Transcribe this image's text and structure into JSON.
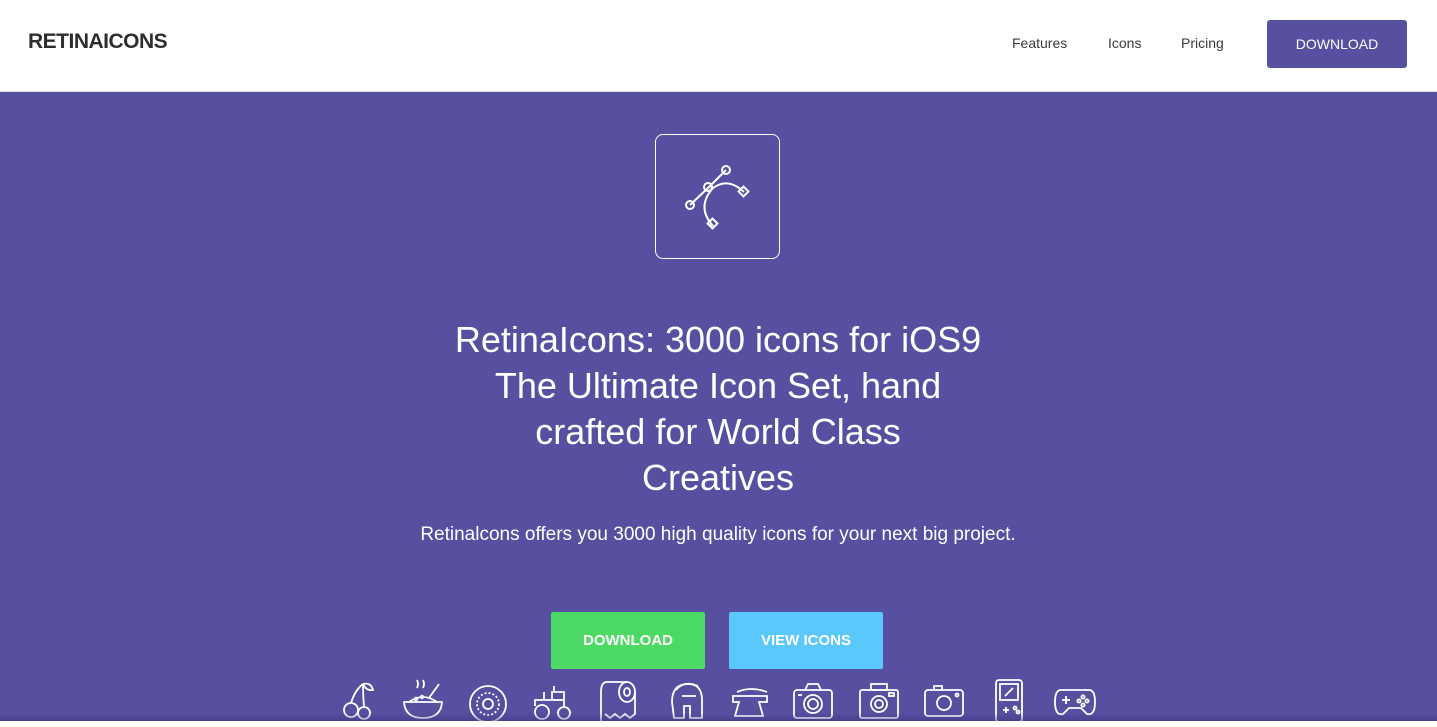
{
  "nav": {
    "brand": "RETINAICONS",
    "links": [
      "Features",
      "Icons",
      "Pricing"
    ],
    "download_label": "DOWNLOAD"
  },
  "hero": {
    "headline_lines": [
      "RetinaIcons: 3000 icons for iOS9",
      "The Ultimate Icon Set, hand",
      "crafted for World Class",
      "Creatives"
    ],
    "subline": "Retinalcons offers you 3000 high quality icons for your next big project.",
    "download_label": "DOWNLOAD",
    "view_icons_label": "VIEW ICONS",
    "logo_icon": "bezier-curve-icon",
    "icons": [
      "cherry-icon",
      "bowl-icon",
      "donut-icon",
      "tractor-icon",
      "toilet-paper-icon",
      "spartan-helmet-icon",
      "anvil-icon",
      "camera-icon",
      "camera-icon",
      "camera-icon",
      "gameboy-icon",
      "gamepad-icon"
    ]
  },
  "colors": {
    "brand_purple": "#574fa0",
    "download_green": "#4cd964",
    "view_blue": "#5ac8fa",
    "text_dark": "#2e2e2e"
  }
}
